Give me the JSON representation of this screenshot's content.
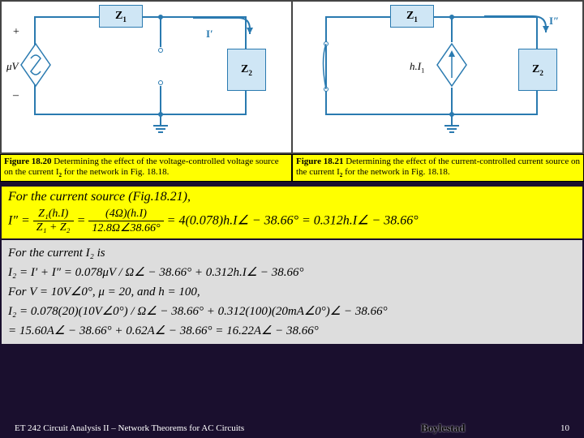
{
  "circuit_left": {
    "z1": "Z",
    "z1sub": "1",
    "z2": "Z",
    "z2sub": "2",
    "src": "μV",
    "iprime": "I′",
    "plus": "+",
    "minus": "–"
  },
  "circuit_right": {
    "z1": "Z",
    "z1sub": "1",
    "z2": "Z",
    "z2sub": "2",
    "src": "h.I",
    "srcsub": "1",
    "idprime": "I″"
  },
  "caption_left_b": "Figure 18.20",
  "caption_left_t": "  Determining the effect of the voltage-controlled voltage source on the current I",
  "caption_left_sub": "2",
  "caption_left_rest": " for the network in Fig. 18.18.",
  "caption_right_b": "Figure 18.21",
  "caption_right_t": "  Determining the effect of the current-controlled current source on the current I",
  "caption_right_sub": "2",
  "caption_right_rest": " for the network in Fig. 18.18.",
  "math1_lead": "For the current source (Fig.18.21),",
  "math1_lhs": "I″ = ",
  "math1_num1": "Z₁(h.I)",
  "math1_den1": "Z₁ + Z₂",
  "math1_mid": " = ",
  "math1_num2": "(4Ω)(h.I)",
  "math1_den2": "12.8Ω∠38.66°",
  "math1_rhs": " = 4(0.078)h.I∠ − 38.66° = 0.312h.I∠ − 38.66°",
  "math2_l1": "For the current I₂ is",
  "math2_l2": "I₂ = I′ + I″ = 0.078μV / Ω∠ − 38.66° + 0.312h.I∠ − 38.66°",
  "math2_l3": "For V = 10V∠0°,  μ = 20,  and  h = 100,",
  "math2_l4": "I₂ = 0.078(20)(10V∠0°) / Ω∠ − 38.66° + 0.312(100)(20mA∠0°)∠ − 38.66°",
  "math2_l5": "= 15.60A∠ − 38.66° + 0.62A∠ − 38.66° = 16.22A∠ − 38.66°",
  "footer_course": "ET 242 Circuit Analysis II – Network Theorems for AC Circuits",
  "footer_author": "Boylestad",
  "footer_page": "10"
}
